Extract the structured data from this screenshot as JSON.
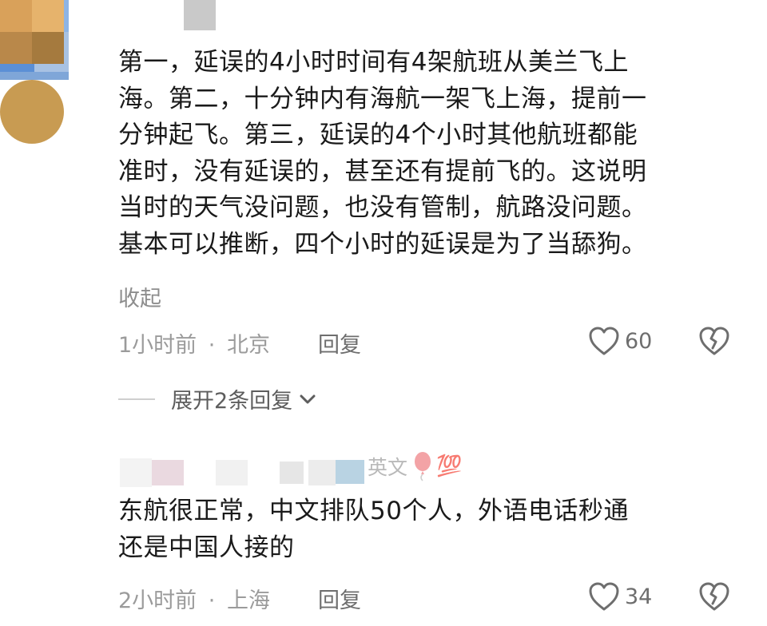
{
  "comments": [
    {
      "lines": [
        "第一，延误的4小时时间有4架航班从美兰飞上",
        "海。第二，十分钟内有海航一架飞上海，提前一",
        "分钟起飞。第三，延误的4个小时其他航班都能",
        "准时，没有延误的，甚至还有提前飞的。这说明",
        "当时的天气没问题，也没有管制，航路没问题。",
        "基本可以推断，四个小时的延误是为了当舔狗。"
      ],
      "collapse_label": "收起",
      "time": "1小时前",
      "location": "北京",
      "reply_label": "回复",
      "likes": "60",
      "icons": {
        "like": "heart-outline-icon",
        "dislike": "broken-heart-icon"
      }
    },
    {
      "username_suffix": "英文",
      "username_emoji": "💯",
      "lines": [
        "东航很正常，中文排队50个人，外语电话秒通",
        "还是中国人接的"
      ],
      "time": "2小时前",
      "location": "上海",
      "reply_label": "回复",
      "likes": "34"
    }
  ],
  "expand_replies_label": "展开2条回复",
  "separator": "·",
  "colors": {
    "meta": "#9b9b9b",
    "text": "#1a1a1a",
    "icon": "#6e6e6e"
  }
}
